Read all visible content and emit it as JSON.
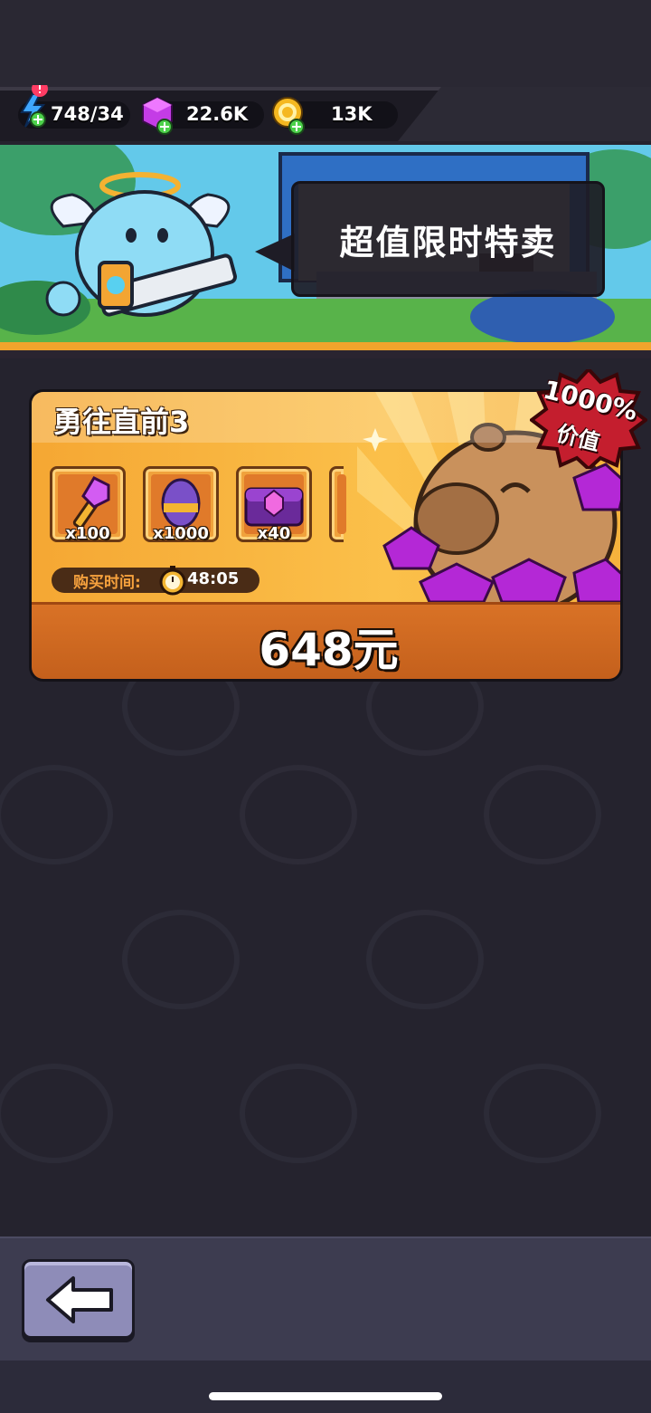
{
  "resources": {
    "energy": "748/34",
    "gems": "22.6K",
    "coins": "13K"
  },
  "banner": {
    "title": "超值限时特卖"
  },
  "offer": {
    "title": "勇往直前3",
    "items": [
      {
        "icon": "purple-key-icon",
        "count": "x100"
      },
      {
        "icon": "egg-icon",
        "count": "x1000"
      },
      {
        "icon": "treasure-chest-icon",
        "count": "x40"
      }
    ],
    "timer_label": "购买时间:",
    "timer_value": "48:05",
    "price": "648元",
    "badge_percent": "1000%",
    "badge_label": "价值"
  }
}
